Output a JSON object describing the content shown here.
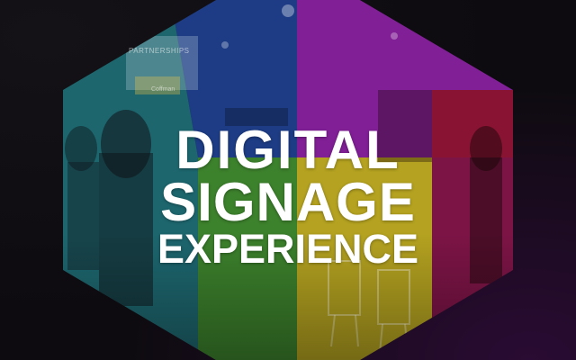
{
  "headline": {
    "line1": "DIGITAL",
    "line2": "SIGNAGE",
    "line3": "EXPERIENCE"
  },
  "background_signage": {
    "booth_sign": "PARTNERSHIPS",
    "booth_logo": "Coffman"
  },
  "colors": {
    "page_background": "#0d0b0f",
    "panel_blue": "#1e3e8a",
    "panel_magenta": "#8a1fa0",
    "panel_teal": "#1d6c74",
    "panel_green": "#3f8a2c",
    "panel_yellow": "#c4b01f",
    "panel_red": "#8a1227",
    "headline": "#ffffff"
  }
}
